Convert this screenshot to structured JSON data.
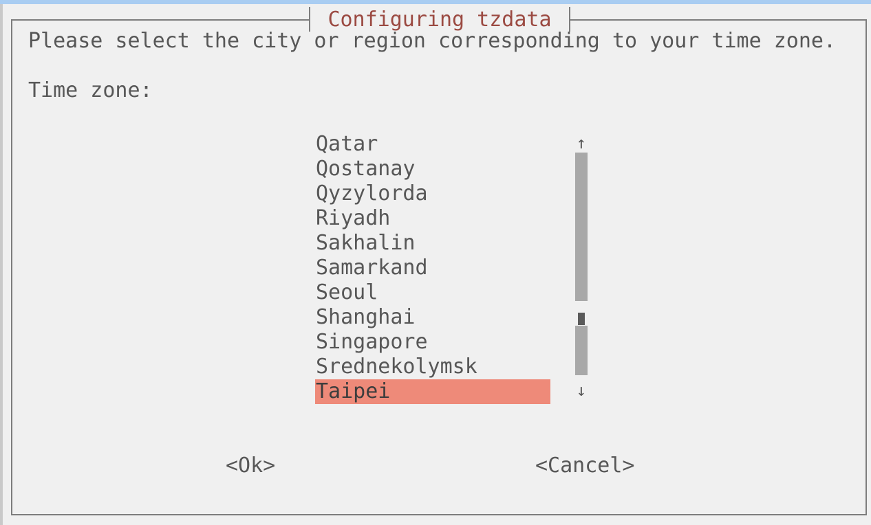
{
  "dialog": {
    "title": "Configuring tzdata",
    "prompt": "Please select the city or region corresponding to your time zone.",
    "field_label": "Time zone:"
  },
  "timezone_list": {
    "items": [
      "Qatar",
      "Qostanay",
      "Qyzylorda",
      "Riyadh",
      "Sakhalin",
      "Samarkand",
      "Seoul",
      "Shanghai",
      "Singapore",
      "Srednekolymsk",
      "Taipei"
    ],
    "selected": "Taipei",
    "scroll_up_glyph": "↑",
    "scroll_down_glyph": "↓"
  },
  "buttons": {
    "ok": "<Ok>",
    "cancel": "<Cancel>"
  },
  "colors": {
    "title_text": "#9b4a42",
    "selection_background": "#ee8a79",
    "dialog_background": "#f0f0f0",
    "top_strip": "#a9cdf2",
    "scrollbar": "#a8a8a8"
  }
}
